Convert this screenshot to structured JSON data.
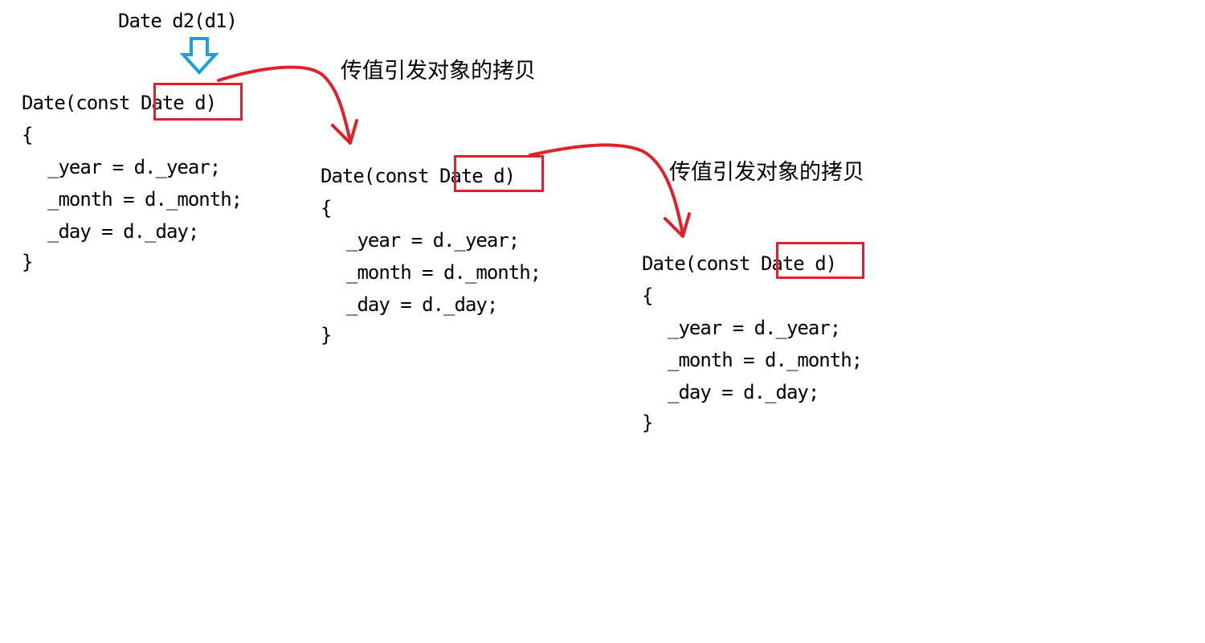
{
  "header_call": "Date d2(d1)",
  "caption": "传值引发对象的拷贝",
  "colors": {
    "highlight": "#e0202a",
    "arrow_red": "#e0202a",
    "arrow_blue": "#1a9fe0",
    "text": "#000000"
  },
  "blocks": [
    {
      "signature_prefix": "Date(const ",
      "signature_param": "Date d",
      "signature_suffix": ")",
      "open_brace": "{",
      "lines": [
        "_year = d._year;",
        "_month = d._month;",
        "_day = d._day;"
      ],
      "close_brace": "}"
    },
    {
      "signature_prefix": "Date(const ",
      "signature_param": "Date d",
      "signature_suffix": ")",
      "open_brace": "{",
      "lines": [
        "_year = d._year;",
        "_month = d._month;",
        "_day = d._day;"
      ],
      "close_brace": "}"
    },
    {
      "signature_prefix": "Date(const ",
      "signature_param": "Date d",
      "signature_suffix": ")",
      "open_brace": "{",
      "lines": [
        "_year = d._year;",
        "_month = d._month;",
        "_day = d._day;"
      ],
      "close_brace": "}"
    }
  ]
}
